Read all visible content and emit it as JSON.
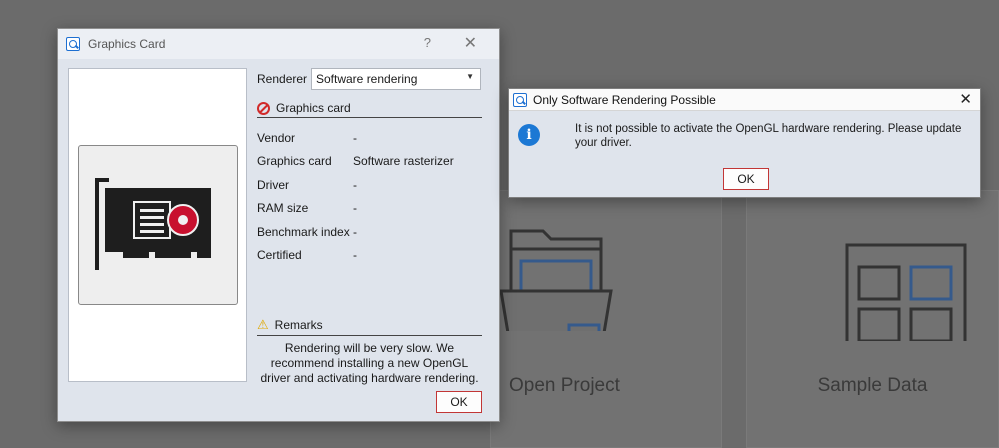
{
  "background": {
    "tiles": [
      {
        "label": "Open Project"
      },
      {
        "label": "Sample Data"
      }
    ]
  },
  "graphics_dialog": {
    "title": "Graphics Card",
    "help": "?",
    "close": "✕",
    "renderer_label": "Renderer",
    "renderer_value": "Software rendering",
    "section_title": "Graphics card",
    "rows": [
      {
        "key": "Vendor",
        "value": "-"
      },
      {
        "key": "Graphics card",
        "value": "Software rasterizer"
      },
      {
        "key": "Driver",
        "value": "-"
      },
      {
        "key": "RAM size",
        "value": "-"
      },
      {
        "key": "Benchmark index",
        "value": "-"
      },
      {
        "key": "Certified",
        "value": "-"
      }
    ],
    "remarks_title": "Remarks",
    "remarks_text": "Rendering will be very slow. We recommend installing a new OpenGL driver and activating hardware rendering.",
    "ok_label": "OK"
  },
  "software_dialog": {
    "title": "Only Software Rendering Possible",
    "close": "✕",
    "message": "It is not possible to activate the OpenGL hardware rendering. Please update your driver.",
    "ok_label": "OK"
  },
  "colors": {
    "accent": "#1d6fd1",
    "error": "#d12a2a",
    "graphics_card_pcb": "#1e1e1e",
    "fan_red": "#c8102e"
  }
}
